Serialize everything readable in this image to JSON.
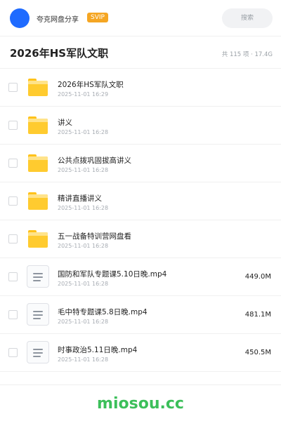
{
  "header": {
    "user_name": "夸克网盘分享",
    "vip_label": "SVIP",
    "search_label": "搜索"
  },
  "folder": {
    "title": "2026年HS军队文职",
    "meta": "共 115 项 · 17.4G"
  },
  "files": [
    {
      "type": "folder",
      "name": "2026年HS军队文职",
      "date": "2025-11-01 16:29",
      "size": ""
    },
    {
      "type": "folder",
      "name": "讲义",
      "date": "2025-11-01 16:28",
      "size": ""
    },
    {
      "type": "folder",
      "name": "公共点拨巩固拔高讲义",
      "date": "2025-11-01 16:28",
      "size": ""
    },
    {
      "type": "folder",
      "name": "精讲直播讲义",
      "date": "2025-11-01 16:28",
      "size": ""
    },
    {
      "type": "folder",
      "name": "五一战备特训营网盘看",
      "date": "2025-11-01 16:28",
      "size": ""
    },
    {
      "type": "file",
      "name": "国防和军队专题课5.10日晚.mp4",
      "date": "2025-11-01 16:28",
      "size": "449.0M"
    },
    {
      "type": "file",
      "name": "毛中特专题课5.8日晚.mp4",
      "date": "2025-11-01 16:28",
      "size": "481.1M"
    },
    {
      "type": "file",
      "name": "时事政治5.11日晚.mp4",
      "date": "2025-11-01 16:28",
      "size": "450.5M"
    }
  ],
  "footer": {
    "watermark": "miosou.cc"
  },
  "colors": {
    "avatar": "#1f6bff",
    "vip_badge": "#f5a623",
    "folder_icon": "#ffcb2f",
    "watermark": "#3cbf5a"
  }
}
